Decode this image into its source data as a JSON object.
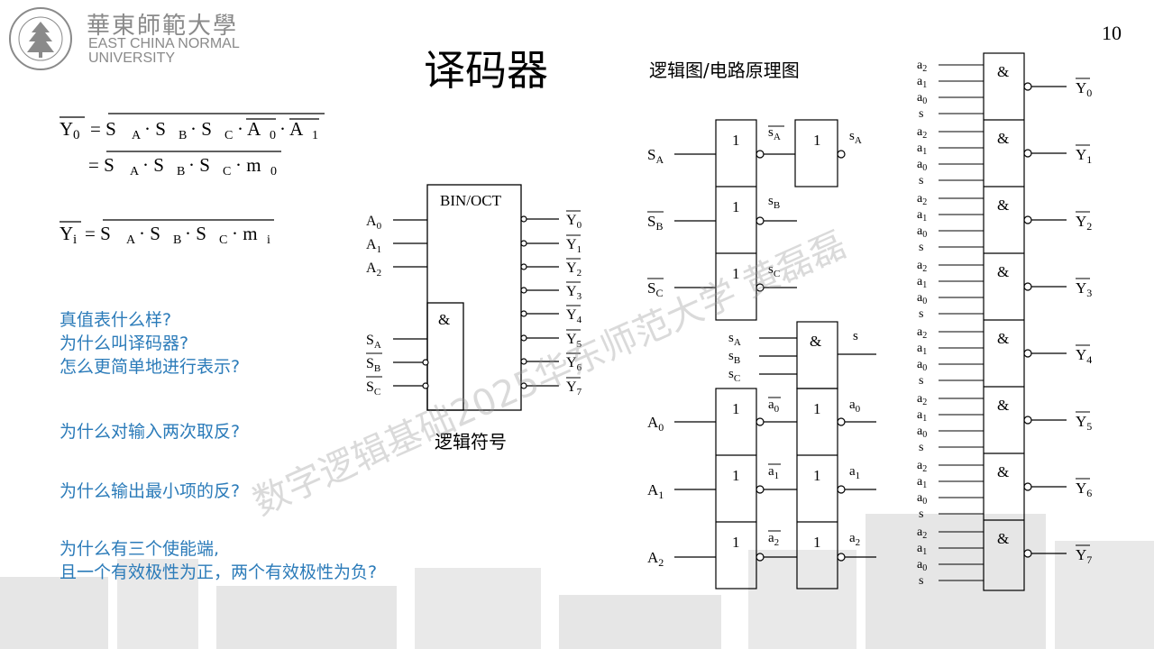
{
  "header": {
    "university_cn": "華東師範大學",
    "university_en_line1": "EAST CHINA NORMAL",
    "university_en_line2": "UNIVERSITY",
    "seal_text": "EAST CHINA NORMAL UNIVERSITY"
  },
  "page_number": "10",
  "title": "译码器",
  "diagram_caption": "逻辑图/电路原理图",
  "symbol_caption": "逻辑符号",
  "watermark": "数字逻辑基础2025华东师范大学 黄磊磊",
  "formulas": {
    "y0_lhs": "Y",
    "y0_lhs_sub": "0",
    "y0_rhs": "= S",
    "y_i_lhs": "Y",
    "y_i_sub": "i"
  },
  "questions": [
    "真值表什么样?",
    "为什么叫译码器?",
    "怎么更简单地进行表示?",
    "为什么对输入两次取反?",
    "为什么输出最小项的反?",
    "为什么有三个使能端,",
    "且一个有效极性为正，两个有效极性为负?"
  ],
  "symbol": {
    "block_label": "BIN/OCT",
    "and_label": "&",
    "inputs": [
      "A0",
      "A1",
      "A2"
    ],
    "enables": [
      "SA",
      "SB",
      "SC"
    ],
    "outputs": [
      "Y0",
      "Y1",
      "Y2",
      "Y3",
      "Y4",
      "Y5",
      "Y6",
      "Y7"
    ]
  },
  "circuit": {
    "not_label": "1",
    "and_label": "&",
    "s_label": "s"
  },
  "colors": {
    "question": "#2b7bb9",
    "logo_gray": "#8a8a8a"
  }
}
